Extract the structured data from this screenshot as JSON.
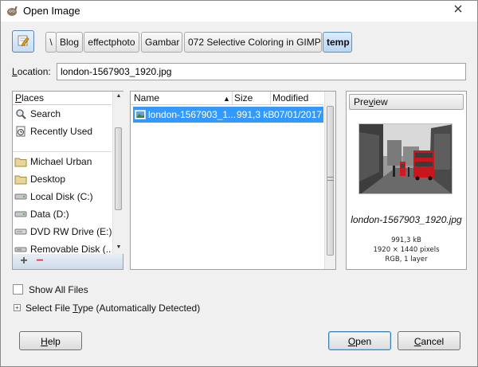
{
  "window": {
    "title": "Open Image",
    "close_icon": "close-icon"
  },
  "pathbar": {
    "edit_icon": "pencil-edit-icon",
    "crumbs": [
      "\\",
      "Blog",
      "effectphoto",
      "Gambar",
      "072 Selective Coloring in GIMP",
      "temp"
    ],
    "active_crumb": "temp"
  },
  "location": {
    "label_prefix": "L",
    "label_rest": "ocation:",
    "value": "london-1567903_1920.jpg"
  },
  "places": {
    "header": "Places",
    "items": [
      {
        "label": "Search",
        "icon": "search-icon"
      },
      {
        "label": "Recently Used",
        "icon": "recent-icon"
      },
      {
        "label": "Michael Urban",
        "icon": "folder-icon"
      },
      {
        "label": "Desktop",
        "icon": "folder-icon"
      },
      {
        "label": "Local Disk (C:)",
        "icon": "drive-icon"
      },
      {
        "label": "Data (D:)",
        "icon": "drive-icon"
      },
      {
        "label": "DVD RW Drive (E:)",
        "icon": "optical-drive-icon"
      },
      {
        "label": "Removable Disk (...",
        "icon": "removable-disk-icon"
      }
    ],
    "add_label": "+",
    "remove_label": "−"
  },
  "files": {
    "columns": {
      "name": "Name",
      "size": "Size",
      "modified": "Modified"
    },
    "sort_indicator": "▲",
    "rows": [
      {
        "name": "london-1567903_1...",
        "size": "991,3 kB",
        "modified": "07/01/2017",
        "selected": true,
        "icon": "image-file-icon"
      }
    ]
  },
  "preview": {
    "button_prefix": "Pre",
    "button_u": "v",
    "button_rest": "iew",
    "filename": "london-1567903_1920.jpg",
    "size": "991,3 kB",
    "dimensions": "1920 × 1440 pixels",
    "mode": "RGB, 1 layer"
  },
  "options": {
    "show_all_files": "Show All Files",
    "show_all_checked": false,
    "file_type_prefix": "Select File ",
    "file_type_u": "T",
    "file_type_rest": "ype (Automatically Detected)"
  },
  "buttons": {
    "help": {
      "u": "H",
      "rest": "elp"
    },
    "open": {
      "u": "O",
      "rest": "pen"
    },
    "cancel": {
      "u": "C",
      "rest": "ancel"
    }
  },
  "colors": {
    "selection": "#3399ff",
    "active_crumb": "#b9d6f4",
    "default_button_border": "#3c7fb1"
  }
}
